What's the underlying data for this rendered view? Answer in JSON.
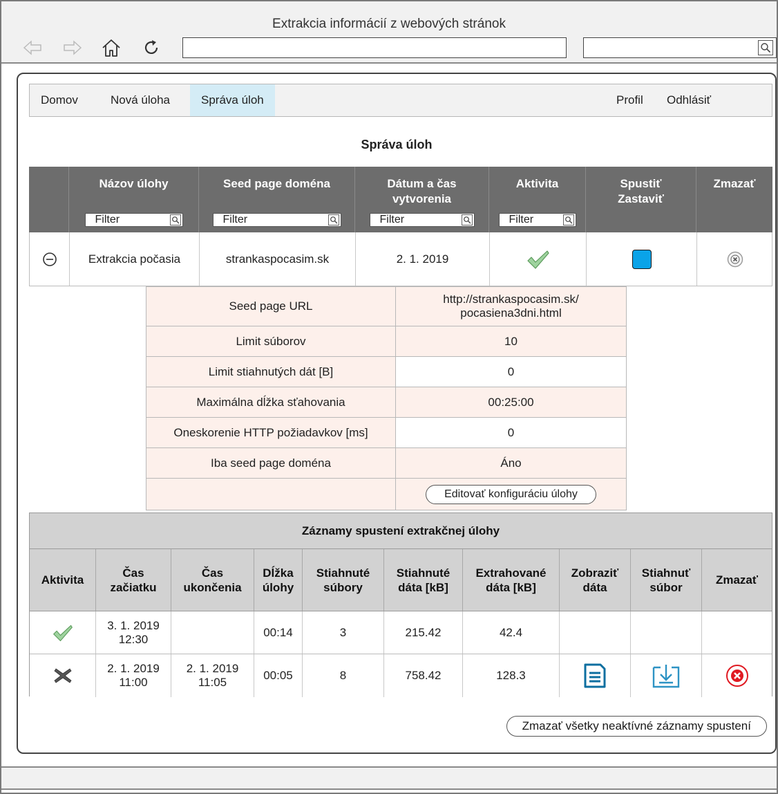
{
  "window": {
    "title": "Extrakcia informácií z webových stránok",
    "url": "",
    "search": ""
  },
  "menu": {
    "home": "Domov",
    "new_task": "Nová úloha",
    "manage": "Správa úloh",
    "profile": "Profil",
    "logout": "Odhlásiť",
    "active_color": "#d4ecf6"
  },
  "page": {
    "title": "Správa úloh"
  },
  "tasks": {
    "headers": {
      "name": "Názov úlohy",
      "domain": "Seed page doména",
      "created_1": "Dátum a čas",
      "created_2": "vytvorenia",
      "activity": "Aktivita",
      "start_1": "Spustiť",
      "start_2": "Zastaviť",
      "delete": "Zmazať"
    },
    "filter_placeholder": "Filter",
    "row": {
      "name": "Extrakcia počasia",
      "domain": "strankaspocasim.sk",
      "created": "2. 1. 2019",
      "activity_icon": "check-icon",
      "start_icon": "stop-square-icon",
      "delete_icon": "delete-circle-icon"
    }
  },
  "config": {
    "rows": [
      {
        "label": "Seed page URL",
        "value_1": "http://strankaspocasim.sk/",
        "value_2": "pocasiena3dni.html"
      },
      {
        "label": "Limit súborov",
        "value": "10"
      },
      {
        "label": "Limit stiahnutých dát [B]",
        "value": "0"
      },
      {
        "label": "Maximálna dĺžka sťahovania",
        "value": "00:25:00"
      },
      {
        "label": "Oneskorenie HTTP požiadavkov [ms]",
        "value": "0"
      },
      {
        "label": "Iba seed page doména",
        "value": "Áno"
      }
    ],
    "edit_button": "Editovať konfiguráciu úlohy"
  },
  "runs": {
    "title": "Záznamy spustení extrakčnej úlohy",
    "headers": {
      "activity": "Aktivita",
      "start_1": "Čas",
      "start_2": "začiatku",
      "end_1": "Čas",
      "end_2": "ukončenia",
      "len_1": "Dĺžka",
      "len_2": "úlohy",
      "files_1": "Stiahnuté",
      "files_2": "súbory",
      "data_1": "Stiahnuté",
      "data_2": "dáta [kB]",
      "extr_1": "Extrahované",
      "extr_2": "dáta [kB]",
      "show_1": "Zobraziť",
      "show_2": "dáta",
      "dl_1": "Stiahnuť",
      "dl_2": "súbor",
      "delete": "Zmazať"
    },
    "rows": [
      {
        "activity_icon": "check-icon",
        "start_1": "3. 1. 2019",
        "start_2": "12:30",
        "end_1": "",
        "end_2": "",
        "length": "00:14",
        "files": "3",
        "data": "215.42",
        "extracted": "42.4"
      },
      {
        "activity_icon": "cross-icon",
        "start_1": "2. 1. 2019",
        "start_2": "11:00",
        "end_1": "2. 1. 2019",
        "end_2": "11:05",
        "length": "00:05",
        "files": "8",
        "data": "758.42",
        "extracted": "128.3"
      }
    ]
  },
  "delete_inactive_button": "Zmazať všetky neaktívné záznamy spustení"
}
